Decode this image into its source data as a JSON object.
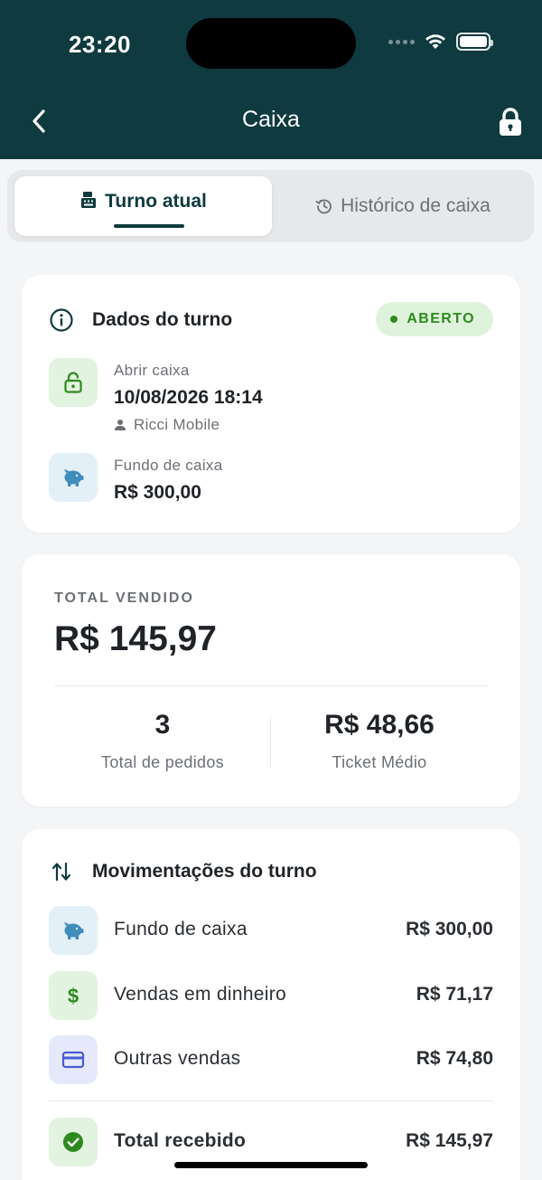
{
  "status_bar": {
    "time": "23:20"
  },
  "header": {
    "title": "Caixa"
  },
  "tabs": [
    {
      "label": "Turno atual",
      "active": true
    },
    {
      "label": "Histórico de caixa",
      "active": false
    }
  ],
  "shift": {
    "title": "Dados do turno",
    "status": "ABERTO",
    "open_label": "Abrir caixa",
    "open_datetime": "10/08/2026 18:14",
    "user": "Ricci Mobile",
    "fund_label": "Fundo de caixa",
    "fund_value": "R$ 300,00"
  },
  "sales": {
    "label": "TOTAL VENDIDO",
    "total": "R$ 145,97",
    "orders_count": "3",
    "orders_label": "Total de pedidos",
    "ticket_value": "R$ 48,66",
    "ticket_label": "Ticket Médio"
  },
  "movements": {
    "title": "Movimentações do turno",
    "items": [
      {
        "label": "Fundo de caixa",
        "value": "R$ 300,00"
      },
      {
        "label": "Vendas em dinheiro",
        "value": "R$ 71,17"
      },
      {
        "label": "Outras vendas",
        "value": "R$ 74,80"
      }
    ],
    "total_label": "Total recebido",
    "total_value": "R$ 145,97"
  },
  "colors": {
    "header_bg": "#0e3a40",
    "accent_green": "#2e8a1f",
    "fund_blue": "#3f8dbb",
    "card_indigo": "#4a5bd1"
  }
}
